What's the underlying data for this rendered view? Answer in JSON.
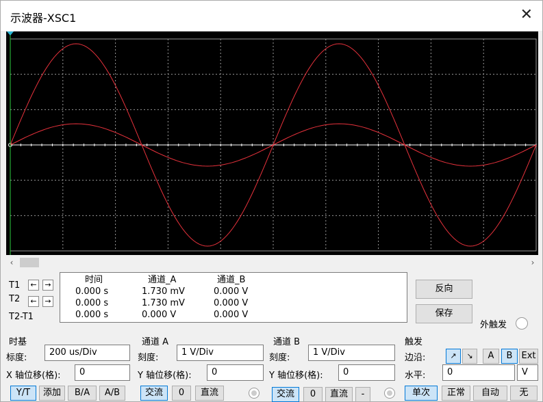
{
  "window": {
    "title": "示波器-XSC1"
  },
  "scroll": {
    "left_arrow": "‹",
    "right_arrow": "›"
  },
  "cursors": {
    "t1": "T1",
    "t2": "T2",
    "t2t1": "T2-T1",
    "left": "←",
    "right": "→"
  },
  "readout": {
    "headers": [
      "时间",
      "通道_A",
      "通道_B"
    ],
    "rows": [
      [
        "0.000 s",
        "1.730 mV",
        "0.000 V"
      ],
      [
        "0.000 s",
        "1.730 mV",
        "0.000 V"
      ],
      [
        "0.000 s",
        "0.000 V",
        "0.000 V"
      ]
    ]
  },
  "actions": {
    "reverse": "反向",
    "save": "保存",
    "external_trigger": "外触发"
  },
  "timebase": {
    "title": "时基",
    "scale_label": "标度:",
    "scale_value": "200 us/Div",
    "xpos_label": "X 轴位移(格):",
    "xpos_value": "0",
    "modes": [
      "Y/T",
      "添加",
      "B/A",
      "A/B"
    ]
  },
  "channel_a": {
    "title": "通道 A",
    "scale_label": "刻度:",
    "scale_value": "1  V/Div",
    "ypos_label": "Y 轴位移(格):",
    "ypos_value": "0",
    "couplings": [
      "交流",
      "0",
      "直流"
    ]
  },
  "channel_b": {
    "title": "通道 B",
    "scale_label": "刻度:",
    "scale_value": "1  V/Div",
    "ypos_label": "Y 轴位移(格):",
    "ypos_value": "0",
    "couplings": [
      "交流",
      "0",
      "直流",
      "-"
    ]
  },
  "trigger": {
    "title": "触发",
    "edge_label": "边沿:",
    "level_label": "水平:",
    "level_value": "0",
    "level_unit": "V",
    "edge_rise": "↗",
    "edge_fall": "↘",
    "sources": [
      "A",
      "B",
      "Ext"
    ],
    "modes": [
      "单次",
      "正常",
      "自动",
      "无"
    ]
  },
  "colors": {
    "screen": "#000000",
    "grid": "#9a9a9a",
    "trace": "#e8323c",
    "cursor": "#2ecc40",
    "axis": "#ffffff"
  }
}
